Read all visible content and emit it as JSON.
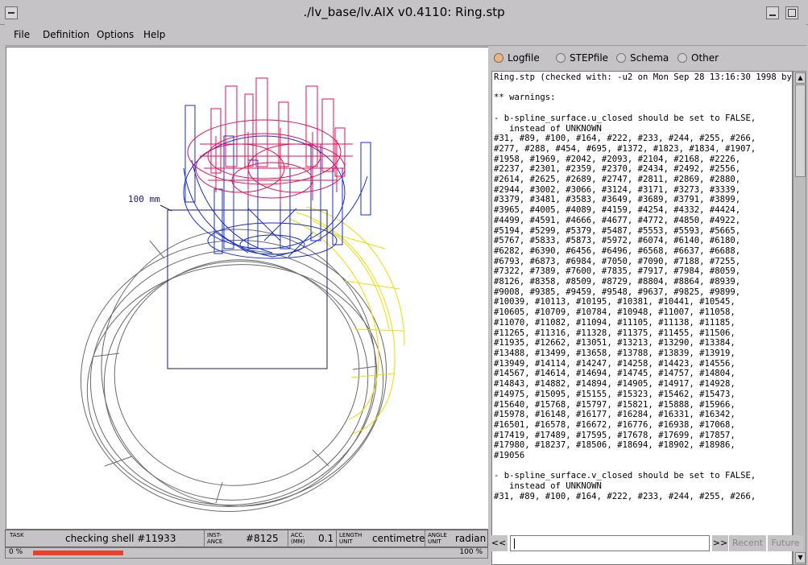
{
  "window": {
    "title": "./lv_base/lv.AIX v0.4110: Ring.stp"
  },
  "menu": {
    "items": [
      "File",
      "Definition",
      "Options",
      "Help"
    ]
  },
  "viewport": {
    "scale_label": "100 mm"
  },
  "tabs": {
    "logfile": "Logfile",
    "stepfile": "STEPfile",
    "schema": "Schema",
    "other": "Other",
    "selected": "Logfile"
  },
  "log": {
    "lines": [
      "Ring.stp (checked with: -u2 on Mon Sep 28 13:16:30 1998 by '",
      "",
      "** warnings:",
      "",
      "- b-spline_surface.u_closed should be set to FALSE,",
      "   instead of UNKNOWN",
      "#31, #89, #100, #164, #222, #233, #244, #255, #266,",
      "#277, #288, #454, #695, #1372, #1823, #1834, #1907,",
      "#1958, #1969, #2042, #2093, #2104, #2168, #2226,",
      "#2237, #2301, #2359, #2370, #2434, #2492, #2556,",
      "#2614, #2625, #2689, #2747, #2811, #2869, #2880,",
      "#2944, #3002, #3066, #3124, #3171, #3273, #3339,",
      "#3379, #3481, #3583, #3649, #3689, #3791, #3899,",
      "#3965, #4005, #4089, #4159, #4254, #4332, #4424,",
      "#4499, #4591, #4666, #4677, #4772, #4850, #4922,",
      "#5194, #5299, #5379, #5487, #5553, #5593, #5665,",
      "#5767, #5833, #5873, #5972, #6074, #6140, #6180,",
      "#6282, #6390, #6456, #6496, #6568, #6637, #6688,",
      "#6793, #6873, #6984, #7050, #7090, #7188, #7255,",
      "#7322, #7389, #7600, #7835, #7917, #7984, #8059,",
      "#8126, #8358, #8509, #8729, #8804, #8864, #8939,",
      "#9008, #9385, #9459, #9548, #9637, #9825, #9899,",
      "#10039, #10113, #10195, #10381, #10441, #10545,",
      "#10605, #10709, #10784, #10948, #11007, #11058,",
      "#11070, #11082, #11094, #11105, #11138, #11185,",
      "#11265, #11316, #11328, #11375, #11455, #11506,",
      "#11935, #12662, #13051, #13213, #13290, #13384,",
      "#13488, #13499, #13658, #13788, #13839, #13919,",
      "#13949, #14114, #14247, #14258, #14423, #14556,",
      "#14567, #14614, #14694, #14745, #14757, #14804,",
      "#14843, #14882, #14894, #14905, #14917, #14928,",
      "#14975, #15095, #15155, #15323, #15462, #15473,",
      "#15640, #15768, #15797, #15821, #15888, #15966,",
      "#15978, #16148, #16177, #16284, #16331, #16342,",
      "#16501, #16578, #16672, #16776, #16938, #17068,",
      "#17419, #17489, #17595, #17678, #17699, #17857,",
      "#17980, #18237, #18506, #18694, #18902, #18986,",
      "#19056",
      "",
      "- b-spline_surface.v_closed should be set to FALSE,",
      "   instead of UNKNOWN",
      "#31, #89, #100, #164, #222, #233, #244, #255, #266,"
    ]
  },
  "nav": {
    "prev": "<<",
    "next": ">>",
    "recent": "Recent",
    "future": "Future"
  },
  "status": {
    "task_label": "TASK",
    "task_value": "checking shell #11933",
    "instance_label": "INST- ANCE",
    "instance_value": "#8125",
    "acc_label": "ACC. (MM)",
    "acc_value": "0.1",
    "length_label": "LENGTH UNIT",
    "length_value": "centimetre",
    "angle_label": "ANGLE UNIT",
    "angle_value": "radian"
  },
  "progress": {
    "left_label": "0 %",
    "right_label": "100 %",
    "fraction": 0.2
  },
  "colors": {
    "gem": "#e0105a",
    "prong": "#1a2ed0",
    "band": "#6a6a6a",
    "highlight": "#e8e000",
    "box": "#1a1a6a"
  }
}
